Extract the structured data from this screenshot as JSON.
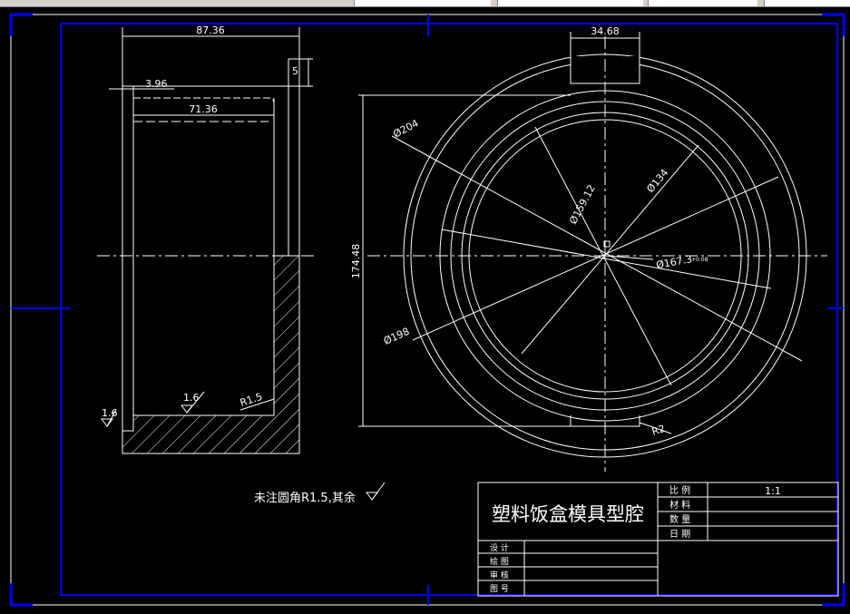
{
  "window": {
    "background": "#000000",
    "frame_color": "#0000ff",
    "line_color": "#ffffff"
  },
  "section_view": {
    "dims": {
      "overall_length": "87.36",
      "flange": "5",
      "wall_offset": "3.96",
      "inner_length": "71.36"
    },
    "roughness": {
      "left": "1.6",
      "bottom": "1.6"
    },
    "fillet": "R1.5"
  },
  "front_view": {
    "dims": {
      "slot_width": "34.68",
      "d204": "Ø204",
      "d159": "Ø159.12",
      "d134": "Ø134",
      "d167": "Ø167.3",
      "d167_tol": "+0.08",
      "d198": "Ø198",
      "height": "174.48",
      "r2": "R2"
    }
  },
  "note": "未注圆角R1.5,其余",
  "title_block": {
    "title": "塑料饭盒模具型腔",
    "labels": {
      "scale": "比  例",
      "material": "材  料",
      "quantity": "数  量",
      "date": "日  期"
    },
    "scale_value": "1:1",
    "rows": {
      "design": "设  计",
      "draw": "绘  图",
      "check": "审  核",
      "number": "图  号"
    }
  }
}
